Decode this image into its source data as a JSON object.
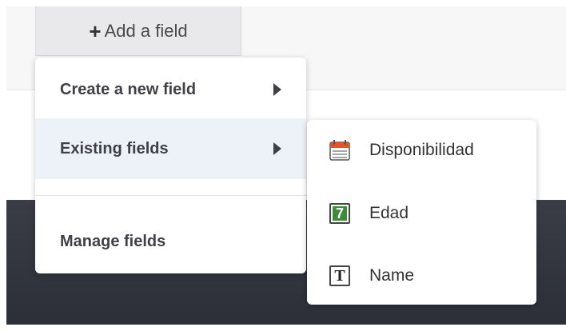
{
  "add_button": {
    "plus": "+",
    "label": "Add a field"
  },
  "menu": {
    "create_label": "Create a new field",
    "existing_label": "Existing fields",
    "manage_label": "Manage fields"
  },
  "submenu": {
    "items": [
      {
        "label": "Disponibilidad",
        "icon": "calendar-icon"
      },
      {
        "label": "Edad",
        "icon": "number-icon",
        "glyph": "7"
      },
      {
        "label": "Name",
        "icon": "text-icon",
        "glyph": "T"
      }
    ]
  },
  "colors": {
    "highlight": "#edf2f8",
    "dark_bg": "#2f323b",
    "calendar_red": "#e0552e",
    "number_green": "#3f8a3a"
  }
}
